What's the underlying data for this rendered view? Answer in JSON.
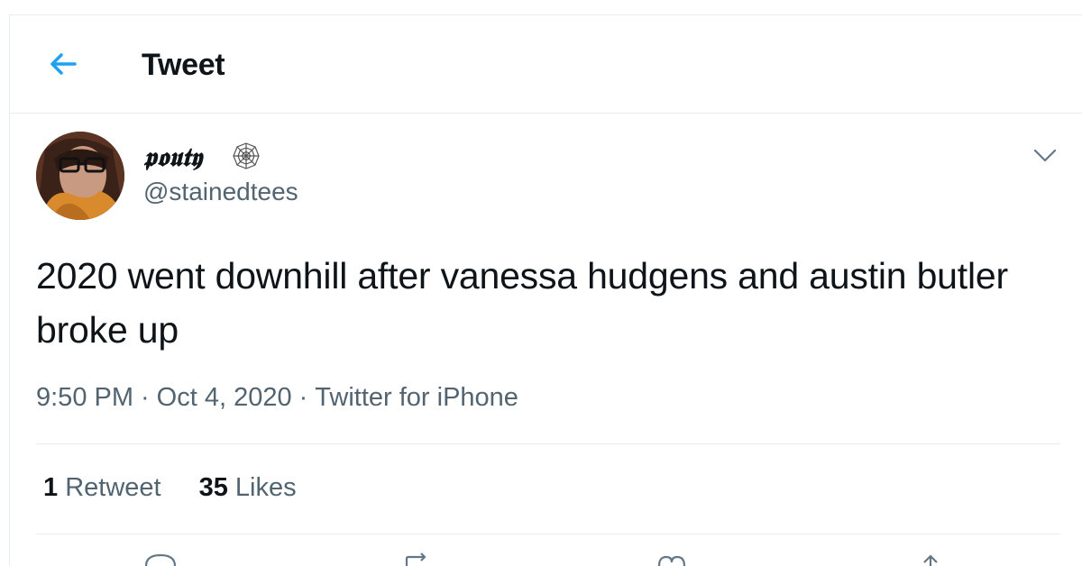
{
  "header": {
    "title": "Tweet",
    "back_icon": "arrow-left-icon",
    "accent_color": "#1da1f2"
  },
  "tweet": {
    "author": {
      "display_name": "𝖕𝖔𝖚𝖙𝖞",
      "badge_icon": "spiderweb-icon",
      "handle": "@stainedtees"
    },
    "text": "2020 went downhill after vanessa hudgens and austin butler broke up",
    "time": "9:50 PM",
    "date": "Oct 4, 2020",
    "separator": "·",
    "source": "Twitter for iPhone",
    "stats": {
      "retweets_count": "1",
      "retweets_label": "Retweet",
      "likes_count": "35",
      "likes_label": "Likes"
    },
    "more_icon": "chevron-down-icon",
    "action_icons": [
      "reply-icon",
      "retweet-icon",
      "like-icon",
      "share-icon"
    ]
  }
}
